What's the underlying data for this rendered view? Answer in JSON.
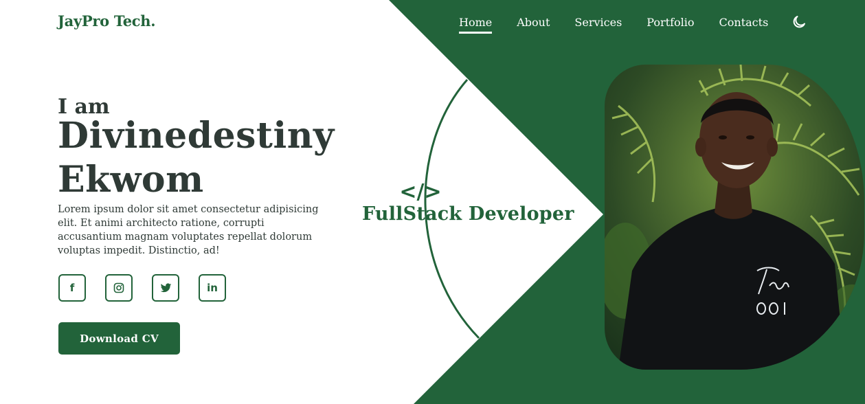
{
  "brand": {
    "logo": "JayPro Tech."
  },
  "nav": {
    "items": [
      {
        "label": "Home",
        "active": true
      },
      {
        "label": "About",
        "active": false
      },
      {
        "label": "Services",
        "active": false
      },
      {
        "label": "Portfolio",
        "active": false
      },
      {
        "label": "Contacts",
        "active": false
      }
    ],
    "theme_toggle_icon": "moon-icon"
  },
  "hero": {
    "greeting": "I am",
    "name": "Divinedestiny Ekwom",
    "description": "Lorem ipsum dolor sit amet consectetur adipisicing elit. Et animi architecto ratione, corrupti accusantium magnam voluptates repellat dolorum voluptas impedit. Distinctio, ad!",
    "cv_button": "Download CV",
    "socials": [
      {
        "name": "facebook",
        "glyph": "f"
      },
      {
        "name": "instagram",
        "icon": "instagram-icon"
      },
      {
        "name": "twitter",
        "icon": "twitter-icon"
      },
      {
        "name": "linkedin",
        "glyph": "in"
      }
    ],
    "code_icon": "</>",
    "role": "FullStack Developer",
    "photo_icon": "portrait-photo"
  },
  "colors": {
    "brand_green": "#22633a",
    "text_dark": "#2f3a36",
    "background": "#ffffff"
  }
}
